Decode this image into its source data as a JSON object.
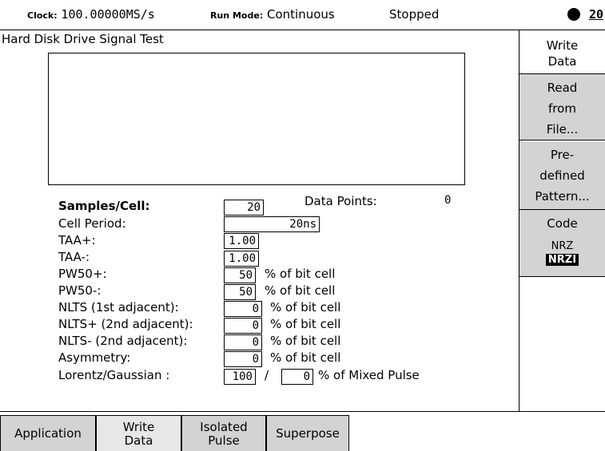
{
  "topbar": {
    "clock_label": "Clock:",
    "clock_value": "100.00000MS/s",
    "run_mode_label": "Run Mode:",
    "run_mode_value": "Continuous",
    "status": "Stopped",
    "indicator_number": "20"
  },
  "main": {
    "title": "Hard Disk Drive Signal Test",
    "data_points_label": "Data Points:",
    "data_points_value": "0",
    "fields": [
      {
        "label": "Samples/Cell:",
        "value": "20",
        "unit": ""
      },
      {
        "label": "Cell Period:",
        "value": "20ns",
        "unit": ""
      },
      {
        "label": "TAA+:",
        "value": "1.00",
        "unit": ""
      },
      {
        "label": "TAA-:",
        "value": "1.00",
        "unit": ""
      },
      {
        "label": "PW50+:",
        "value": "50",
        "unit": "% of bit cell"
      },
      {
        "label": "PW50-:",
        "value": "50",
        "unit": "% of bit cell"
      },
      {
        "label": "NLTS (1st adjacent):",
        "value": "0",
        "unit": "% of bit cell"
      },
      {
        "label": "NLTS+ (2nd adjacent):",
        "value": "0",
        "unit": "% of bit cell"
      },
      {
        "label": "NLTS- (2nd adjacent):",
        "value": "0",
        "unit": "% of bit cell"
      },
      {
        "label": "Asymmetry:",
        "value": "0",
        "unit": "% of bit cell"
      },
      {
        "label": "Lorentz/Gaussian :",
        "value": "100",
        "separator": "/",
        "value2": "0",
        "unit": "% of Mixed Pulse"
      }
    ]
  },
  "right_menu": {
    "write_data": "Write Data",
    "read_from_file_1": "Read",
    "read_from_file_2": "from",
    "read_from_file_3": "File...",
    "predefined_1": "Pre-",
    "predefined_2": "defined",
    "predefined_3": "Pattern...",
    "code_label": "Code",
    "code_option_1": "NRZ",
    "code_option_2": "NRZI"
  },
  "bottom_tabs": {
    "application": "Application",
    "write_data_1": "Write",
    "write_data_2": "Data",
    "isolated_pulse_1": "Isolated",
    "isolated_pulse_2": "Pulse",
    "superpose": "Superpose"
  },
  "colors": {
    "key_background": "#d3d3d3",
    "selected_background": "#000000"
  }
}
